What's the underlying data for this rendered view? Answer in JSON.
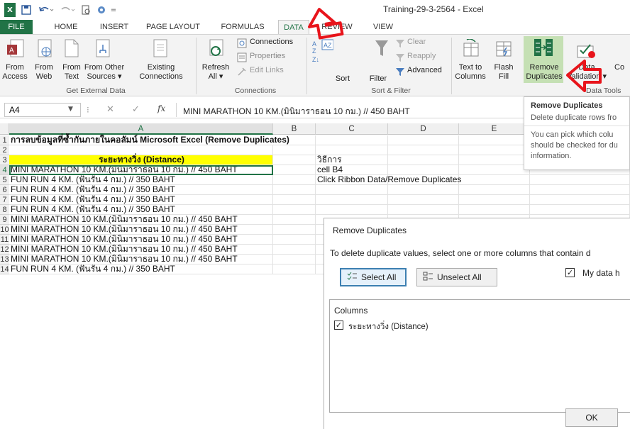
{
  "window": {
    "title": "Training-29-3-2564 - Excel"
  },
  "tabs": [
    "FILE",
    "HOME",
    "INSERT",
    "PAGE LAYOUT",
    "FORMULAS",
    "DATA",
    "REVIEW",
    "VIEW"
  ],
  "ribbon": {
    "get_external": {
      "from_access": [
        "From",
        "Access"
      ],
      "from_web": [
        "From",
        "Web"
      ],
      "from_text": [
        "From",
        "Text"
      ],
      "from_other": [
        "From Other",
        "Sources ▾"
      ],
      "existing": [
        "Existing",
        "Connections"
      ],
      "group": "Get External Data"
    },
    "connections": {
      "refresh": [
        "Refresh",
        "All ▾"
      ],
      "connections": "Connections",
      "properties": "Properties",
      "edit_links": "Edit Links",
      "group": "Connections"
    },
    "sort_filter": {
      "sort": "Sort",
      "filter": "Filter",
      "clear": "Clear",
      "reapply": "Reapply",
      "advanced": "Advanced",
      "group": "Sort & Filter"
    },
    "data_tools": {
      "text_to_columns": [
        "Text to",
        "Columns"
      ],
      "flash_fill": [
        "Flash",
        "Fill"
      ],
      "remove_duplicates": [
        "Remove",
        "Duplicates"
      ],
      "data_validation": [
        "Data",
        "Validation ▾"
      ],
      "consolidate": "Co",
      "group": "Data Tools"
    }
  },
  "formula_bar": {
    "name_box": "A4",
    "formula": "MINI MARATHON 10 KM.(มินิมาราธอน 10 กม.) // 450 BAHT"
  },
  "grid": {
    "columns": [
      "A",
      "B",
      "C",
      "D",
      "E"
    ],
    "rows": [
      {
        "n": "1",
        "a": "การลบข้อมูลที่ซ้ำกันภายในคอลัมน์ Microsoft Excel (Remove Duplicates)",
        "c": ""
      },
      {
        "n": "2",
        "a": "",
        "c": ""
      },
      {
        "n": "3",
        "a": "ระยะทางวิ่ง (Distance)",
        "c": "วิธีการ"
      },
      {
        "n": "4",
        "a": "MINI MARATHON 10 KM.(มินิมาราธอน 10 กม.) // 450 BAHT",
        "c": "cell B4"
      },
      {
        "n": "5",
        "a": "FUN RUN 4 KM. (ฟันรัน 4 กม.) // 350 BAHT",
        "c": "Click Ribbon Data/Remove Duplicates"
      },
      {
        "n": "6",
        "a": "FUN RUN 4 KM. (ฟันรัน 4 กม.) // 350 BAHT",
        "c": ""
      },
      {
        "n": "7",
        "a": "FUN RUN 4 KM. (ฟันรัน 4 กม.) // 350 BAHT",
        "c": ""
      },
      {
        "n": "8",
        "a": "FUN RUN 4 KM. (ฟันรัน 4 กม.) // 350 BAHT",
        "c": ""
      },
      {
        "n": "9",
        "a": "MINI MARATHON 10 KM.(มินิมาราธอน 10 กม.) // 450 BAHT",
        "c": ""
      },
      {
        "n": "10",
        "a": "MINI MARATHON 10 KM.(มินิมาราธอน 10 กม.) // 450 BAHT",
        "c": ""
      },
      {
        "n": "11",
        "a": "MINI MARATHON 10 KM.(มินิมาราธอน 10 กม.) // 450 BAHT",
        "c": ""
      },
      {
        "n": "12",
        "a": "MINI MARATHON 10 KM.(มินิมาราธอน 10 กม.) // 450 BAHT",
        "c": ""
      },
      {
        "n": "13",
        "a": "MINI MARATHON 10 KM.(มินิมาราธอน 10 กม.) // 450 BAHT",
        "c": ""
      },
      {
        "n": "14",
        "a": "FUN RUN 4 KM. (ฟันรัน 4 กม.) // 350 BAHT",
        "c": ""
      }
    ]
  },
  "tooltip": {
    "title": "Remove Duplicates",
    "lines": [
      "Delete duplicate rows fro",
      "",
      "You can pick which colu",
      "should be checked for du",
      "information."
    ]
  },
  "dialog": {
    "title": "Remove Duplicates",
    "instruction": "To delete duplicate values, select one or more columns that contain d",
    "select_all": "Select All",
    "unselect_all": "Unselect All",
    "my_data_headers": "My data h",
    "columns_label": "Columns",
    "column_item": "ระยะทางวิ่ง (Distance)",
    "ok": "OK"
  },
  "colors": {
    "excel_green": "#217346",
    "highlight_yellow": "#ffff00",
    "arrow_red": "#e8141b"
  }
}
